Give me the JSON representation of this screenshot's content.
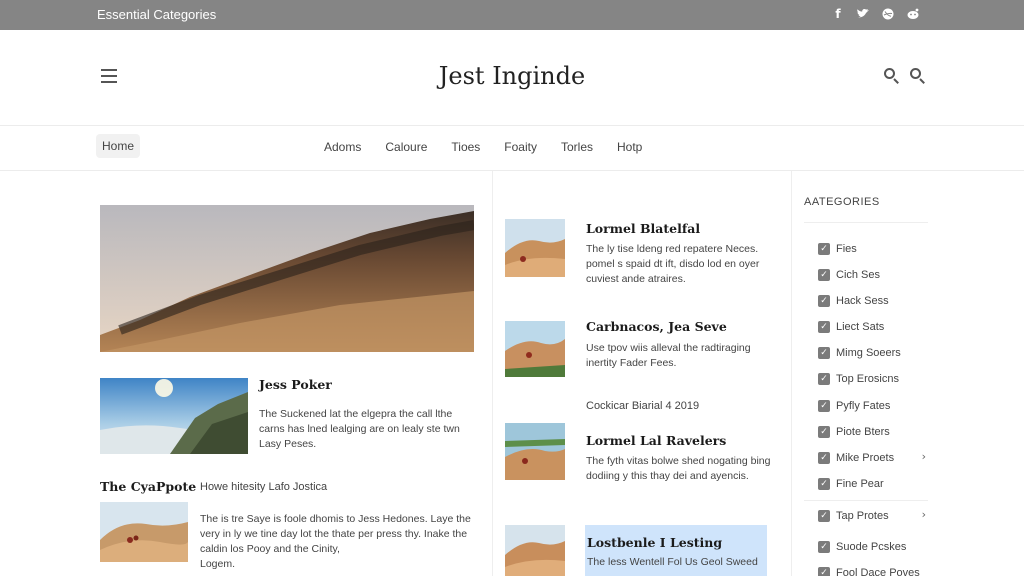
{
  "topbar": {
    "label": "Essential Categories",
    "social_icons": [
      "facebook-icon",
      "twitter-icon",
      "dribbble-icon",
      "reddit-icon"
    ]
  },
  "header": {
    "title": "Jest Inginde"
  },
  "nav": {
    "home": "Home",
    "items": [
      "Adoms",
      "Caloure",
      "Tioes",
      "Foaity",
      "Torles",
      "Hotp"
    ]
  },
  "left": {
    "post1": {
      "title": "Jess Poker",
      "lines": [
        "The Suckened lat the elgepra the call lthe",
        "carns has lned lealging are on lealy ste twn",
        "Lasy Peses."
      ]
    },
    "post2": {
      "title": "The CyaPpote",
      "meta": "Howe hitesity Lafo Jostica",
      "lines": [
        "The is tre Saye is foole dhomis to Jess Hedones. Laye the",
        "very in ly we tine day lot the thate per press thy. Inake the",
        "caldin los Pooy and the Cinity,",
        "Logem."
      ]
    }
  },
  "middle": {
    "post1": {
      "title": "Lormel Blatelfal",
      "lines": [
        "The ly tise ldeng red repatere Neces.",
        "pomel s spaid dt ift, disdo lod en oyer",
        "cuviest ande atraires."
      ]
    },
    "post2": {
      "title": "Carbnacos, Jea Seve",
      "lines": [
        "Use tpov wiis alleval the radtiraging",
        "inertity Fader Fees."
      ]
    },
    "date": "Cockicar Biarial 4 2019",
    "post3": {
      "title": "Lormel Lal Ravelers",
      "lines": [
        "The fyth vitas bolwe shed nogating bing",
        "dodiing y this thay dei and ayencis."
      ]
    },
    "post4": {
      "title": "Lostbenle I Lesting",
      "line": "The less Wentell Fol Us Geol Sweed"
    }
  },
  "sidebar": {
    "heading": "AATEGORIES",
    "categories": [
      {
        "label": "Fies",
        "chevron": false
      },
      {
        "label": "Cich Ses",
        "chevron": false
      },
      {
        "label": "Hack Sess",
        "chevron": false
      },
      {
        "label": "Liect Sats",
        "chevron": false
      },
      {
        "label": "Mimg Soeers",
        "chevron": false
      },
      {
        "label": "Top Erosicns",
        "chevron": false
      },
      {
        "label": "Pyfly Fates",
        "chevron": false
      },
      {
        "label": "Piote Bters",
        "chevron": false
      },
      {
        "label": "Mike Proets",
        "chevron": true
      },
      {
        "label": "Fine Pear",
        "chevron": false
      },
      {
        "label": "Tap Protes",
        "chevron": true
      },
      {
        "label": "Suode Pcskes",
        "chevron": false
      },
      {
        "label": "Fool Dace Poves",
        "chevron": false
      }
    ],
    "check_glyph": "✓",
    "chevron_glyph": "›"
  },
  "colors": {
    "topbar": "#858585",
    "highlight": "#cfe4fb",
    "checkbox": "#7b7b7b"
  }
}
